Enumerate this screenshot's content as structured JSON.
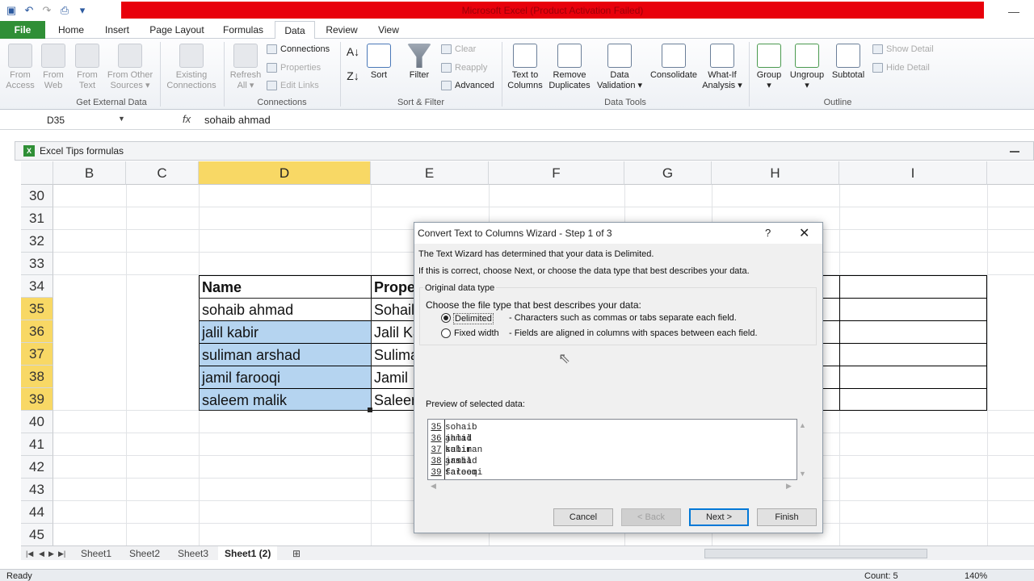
{
  "window": {
    "title": "Microsoft Excel (Product Activation Failed)"
  },
  "ribbon_tabs": [
    "File",
    "Home",
    "Insert",
    "Page Layout",
    "Formulas",
    "Data",
    "Review",
    "View"
  ],
  "active_tab": "Data",
  "groups": {
    "get_external": {
      "label": "Get External Data",
      "buttons": [
        {
          "l1": "From",
          "l2": "Access"
        },
        {
          "l1": "From",
          "l2": "Web"
        },
        {
          "l1": "From",
          "l2": "Text"
        },
        {
          "l1": "From Other",
          "l2": "Sources ▾"
        },
        {
          "l1": "Existing",
          "l2": "Connections"
        }
      ]
    },
    "connections": {
      "label": "Connections",
      "refresh": {
        "l1": "Refresh",
        "l2": "All ▾"
      },
      "items": [
        "Connections",
        "Properties",
        "Edit Links"
      ]
    },
    "sort_filter": {
      "label": "Sort & Filter",
      "sort": "Sort",
      "filter": "Filter",
      "items": [
        "Clear",
        "Reapply",
        "Advanced"
      ]
    },
    "data_tools": {
      "label": "Data Tools",
      "buttons": [
        {
          "l1": "Text to",
          "l2": "Columns"
        },
        {
          "l1": "Remove",
          "l2": "Duplicates"
        },
        {
          "l1": "Data",
          "l2": "Validation ▾"
        },
        {
          "l1": "Consolidate",
          "l2": ""
        },
        {
          "l1": "What-If",
          "l2": "Analysis ▾"
        }
      ]
    },
    "outline": {
      "label": "Outline",
      "buttons": [
        {
          "l1": "Group",
          "l2": "▾"
        },
        {
          "l1": "Ungroup",
          "l2": "▾"
        },
        {
          "l1": "Subtotal",
          "l2": ""
        }
      ],
      "items": [
        "Show Detail",
        "Hide Detail"
      ]
    }
  },
  "formula_bar": {
    "name_box": "D35",
    "fx": "fx",
    "content": "sohaib ahmad"
  },
  "workbook": {
    "title": "Excel Tips formulas"
  },
  "columns": [
    "B",
    "C",
    "D",
    "E",
    "F",
    "G",
    "H",
    "I"
  ],
  "rows": [
    "30",
    "31",
    "32",
    "33",
    "34",
    "35",
    "36",
    "37",
    "38",
    "39",
    "40",
    "41",
    "42",
    "43",
    "44",
    "45"
  ],
  "cells": {
    "d34": "Name",
    "e34": "Prope",
    "d35": "sohaib ahmad",
    "e35": "Sohail",
    "d36": "jalil kabir",
    "e36": "Jalil Ka",
    "d37": "suliman arshad",
    "e37": "Sulima",
    "d38": "jamil farooqi",
    "e38": "Jamil",
    "d39": "saleem malik",
    "e39": "Saleer"
  },
  "sheets": [
    "Sheet1",
    "Sheet2",
    "Sheet3",
    "Sheet1 (2)"
  ],
  "status": {
    "ready": "Ready",
    "count": "Count: 5",
    "zoom": "140%"
  },
  "dialog": {
    "title": "Convert Text to Columns Wizard - Step 1 of 3",
    "help": "?",
    "line1": "The Text Wizard has determined that your data is Delimited.",
    "line2": "If this is correct, choose Next, or choose the data type that best describes your data.",
    "group_label": "Original data type",
    "choose": "Choose the file type that best describes your data:",
    "opt1": "Delimited",
    "opt1_desc": "- Characters such as commas or tabs separate each field.",
    "opt2": "Fixed width",
    "opt2_desc": "- Fields are aligned in columns with spaces between each field.",
    "preview_label": "Preview of selected data:",
    "preview": [
      {
        "n": "35",
        "t": "sohaib ahmad"
      },
      {
        "n": "36",
        "t": "jalil kabir"
      },
      {
        "n": "37",
        "t": "suliman arshad"
      },
      {
        "n": "38",
        "t": "jamil farooqi"
      },
      {
        "n": "39",
        "t": "saleem malik"
      }
    ],
    "buttons": {
      "cancel": "Cancel",
      "back": "< Back",
      "next": "Next >",
      "finish": "Finish"
    }
  },
  "colors": {
    "file_tab": "#2f8f36",
    "selection": "#b5d4f0",
    "header_sel": "#f8d865",
    "title_red": "#e8000b"
  }
}
